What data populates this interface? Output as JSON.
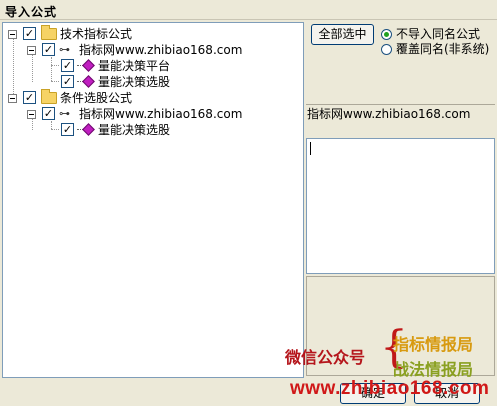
{
  "window": {
    "title": "导入公式"
  },
  "tree": {
    "root1": {
      "label": "技术指标公式"
    },
    "child1": {
      "label": "指标网www.zhibiao168.com"
    },
    "leaf1": {
      "label": "量能决策平台"
    },
    "leaf2": {
      "label": "量能决策选股"
    },
    "root2": {
      "label": "条件选股公式"
    },
    "child2": {
      "label": "指标网www.zhibiao168.com"
    },
    "leaf3": {
      "label": "量能决策选股"
    },
    "check_mark": "✓"
  },
  "controls": {
    "select_all": "全部选中",
    "radio_no_import": "不导入同名公式",
    "radio_overwrite": "覆盖同名(非系统)",
    "selected_option": "不导入同名公式"
  },
  "info": {
    "path": "指标网www.zhibiao168.com"
  },
  "footer": {
    "ok": "确定",
    "cancel": "取消"
  },
  "watermark": {
    "wechat": "微信公众号",
    "brace": "{",
    "line1": "指标情报局",
    "line2": "战法情报局",
    "url": "www.zhibiao168.com"
  },
  "colors": {
    "watermark_red": "#d01818",
    "check_border": "#1c5180",
    "radio_dot": "#21a121"
  }
}
